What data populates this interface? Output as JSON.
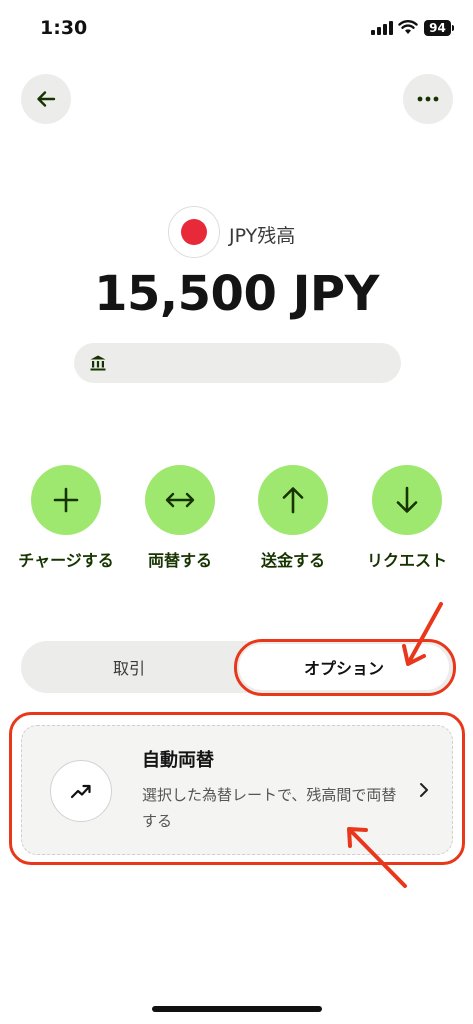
{
  "status_bar": {
    "time": "1:30",
    "battery": "94"
  },
  "balance": {
    "label": "JPY残高",
    "amount": "15,500 JPY",
    "flag_color": "#e8293a"
  },
  "actions": [
    {
      "label": "チャージする",
      "icon": "plus-icon"
    },
    {
      "label": "両替する",
      "icon": "swap-arrows-icon"
    },
    {
      "label": "送金する",
      "icon": "arrow-up-icon"
    },
    {
      "label": "リクエスト",
      "icon": "arrow-down-icon"
    }
  ],
  "tabs": {
    "transactions": "取引",
    "options": "オプション",
    "selected": "options"
  },
  "option_card": {
    "title": "自動両替",
    "description": "選択した為替レートで、残高間で両替する",
    "icon": "trending-up-icon"
  },
  "colors": {
    "accent": "#9fe870",
    "accent_text": "#163300",
    "annotation": "#e8371b"
  }
}
